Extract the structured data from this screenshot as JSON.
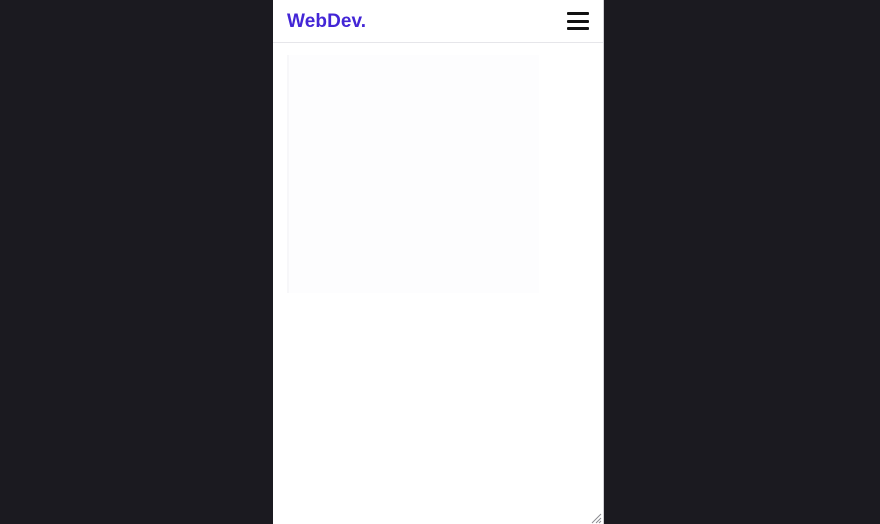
{
  "navbar": {
    "brand": "WebDev.",
    "menu_icon": "hamburger-menu-icon"
  },
  "colors": {
    "brand": "#4326d6",
    "backdrop": "#1b1a20",
    "surface": "#ffffff"
  },
  "icons": {
    "resize": "resize-grip-icon"
  }
}
